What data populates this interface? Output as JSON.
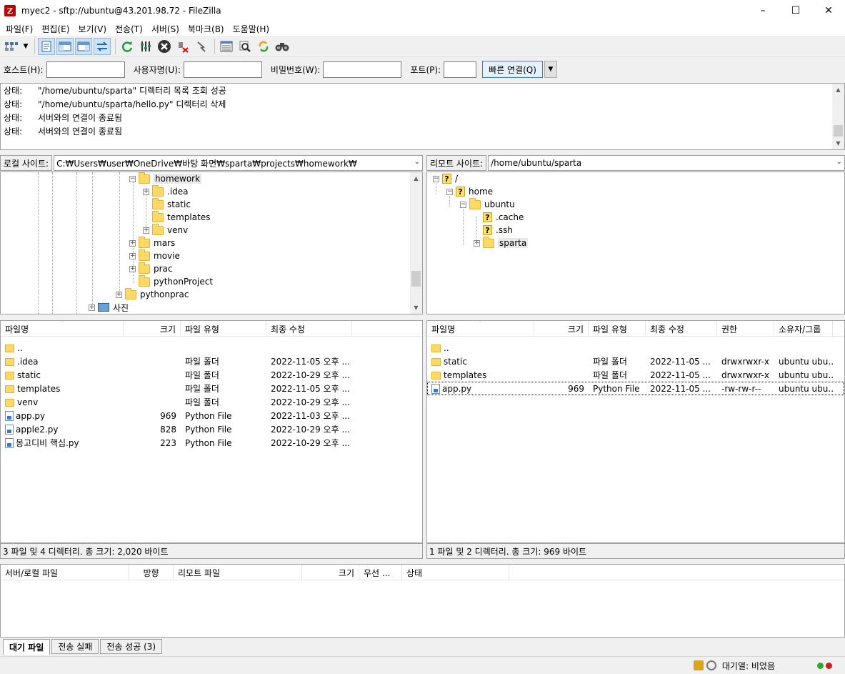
{
  "window": {
    "title": "myec2 - sftp://ubuntu@43.201.98.72 - FileZilla",
    "app_icon": "Z"
  },
  "menu": [
    "파일(F)",
    "편집(E)",
    "보기(V)",
    "전송(T)",
    "서버(S)",
    "북마크(B)",
    "도움말(H)"
  ],
  "quickconnect": {
    "host_label": "호스트(H):",
    "host_value": "",
    "user_label": "사용자명(U):",
    "user_value": "",
    "pass_label": "비밀번호(W):",
    "pass_value": "",
    "port_label": "포트(P):",
    "port_value": "",
    "connect_label": "빠른 연결(Q)"
  },
  "log": [
    {
      "type": "상태:",
      "msg": "\"/home/ubuntu/sparta\" 디렉터리 목록 조회 성공"
    },
    {
      "type": "상태:",
      "msg": "\"/home/ubuntu/sparta/hello.py\" 디렉터리 삭제"
    },
    {
      "type": "상태:",
      "msg": "서버와의 연결이 종료됨"
    },
    {
      "type": "상태:",
      "msg": "서버와의 연결이 종료됨"
    }
  ],
  "local": {
    "site_label": "로컬 사이트:",
    "path": "C:₩Users₩user₩OneDrive₩바탕 화면₩sparta₩projects₩homework₩",
    "tree": [
      {
        "name": "homework",
        "expander": "−"
      },
      {
        "name": ".idea",
        "expander": "+"
      },
      {
        "name": "static",
        "expander": ""
      },
      {
        "name": "templates",
        "expander": ""
      },
      {
        "name": "venv",
        "expander": "+"
      },
      {
        "name": "mars",
        "expander": "+"
      },
      {
        "name": "movie",
        "expander": "+"
      },
      {
        "name": "prac",
        "expander": "+"
      },
      {
        "name": "pythonProject",
        "expander": ""
      },
      {
        "name": "pythonprac",
        "expander": "+"
      },
      {
        "name": "사진",
        "expander": "+"
      }
    ],
    "columns": [
      "파일명",
      "크기",
      "파일 유형",
      "최종 수정"
    ],
    "files": [
      {
        "name": "..",
        "size": "",
        "type": "",
        "modified": ""
      },
      {
        "name": ".idea",
        "size": "",
        "type": "파일 폴더",
        "modified": "2022-11-05 오후 ..."
      },
      {
        "name": "static",
        "size": "",
        "type": "파일 폴더",
        "modified": "2022-10-29 오후 ..."
      },
      {
        "name": "templates",
        "size": "",
        "type": "파일 폴더",
        "modified": "2022-11-05 오후 ..."
      },
      {
        "name": "venv",
        "size": "",
        "type": "파일 폴더",
        "modified": "2022-10-29 오후 ..."
      },
      {
        "name": "app.py",
        "size": "969",
        "type": "Python File",
        "modified": "2022-11-03 오후 ..."
      },
      {
        "name": "apple2.py",
        "size": "828",
        "type": "Python File",
        "modified": "2022-10-29 오후 ..."
      },
      {
        "name": "몽고디비 핵심.py",
        "size": "223",
        "type": "Python File",
        "modified": "2022-10-29 오후 ..."
      }
    ],
    "status": "3 파일 및 4 디렉터리. 총 크기: 2,020 바이트"
  },
  "remote": {
    "site_label": "리모트 사이트:",
    "path": "/home/ubuntu/sparta",
    "tree": [
      {
        "name": "/",
        "expander": "−"
      },
      {
        "name": "home",
        "expander": "−"
      },
      {
        "name": "ubuntu",
        "expander": "−"
      },
      {
        "name": ".cache",
        "expander": ""
      },
      {
        "name": ".ssh",
        "expander": ""
      },
      {
        "name": "sparta",
        "expander": "+"
      }
    ],
    "columns": [
      "파일명",
      "크기",
      "파일 유형",
      "최종 수정",
      "권한",
      "소유자/그룹"
    ],
    "files": [
      {
        "name": "..",
        "size": "",
        "type": "",
        "modified": "",
        "perms": "",
        "owner": ""
      },
      {
        "name": "static",
        "size": "",
        "type": "파일 폴더",
        "modified": "2022-11-05 ...",
        "perms": "drwxrwxr-x",
        "owner": "ubuntu ubu..."
      },
      {
        "name": "templates",
        "size": "",
        "type": "파일 폴더",
        "modified": "2022-11-05 ...",
        "perms": "drwxrwxr-x",
        "owner": "ubuntu ubu..."
      },
      {
        "name": "app.py",
        "size": "969",
        "type": "Python File",
        "modified": "2022-11-05 ...",
        "perms": "-rw-rw-r--",
        "owner": "ubuntu ubu..."
      }
    ],
    "status": "1 파일 및 2 디렉터리. 총 크기: 969 바이트"
  },
  "queue": {
    "columns": [
      "서버/로컬 파일",
      "방향",
      "리모트 파일",
      "크기",
      "우선 ...",
      "상태"
    ],
    "tabs": [
      "대기 파일",
      "전송 실패",
      "전송 성공 (3)"
    ]
  },
  "statusbar": {
    "queue_text": "대기열: 비었음"
  },
  "colors": {
    "folder": "#ffd966",
    "accent": "#3c7fb1",
    "led_green": "#2fa82f",
    "led_red": "#c81e1e"
  },
  "toolbar_icons": [
    "site-manager-icon",
    "dropdown-icon",
    "toggle-log-icon",
    "toggle-local-tree-icon",
    "toggle-remote-tree-icon",
    "toggle-queue-icon",
    "refresh-icon",
    "process-queue-icon",
    "cancel-icon",
    "disconnect-icon",
    "reconnect-icon",
    "directory-listing-filter-icon",
    "search-icon",
    "sync-browse-icon",
    "compare-icon"
  ]
}
